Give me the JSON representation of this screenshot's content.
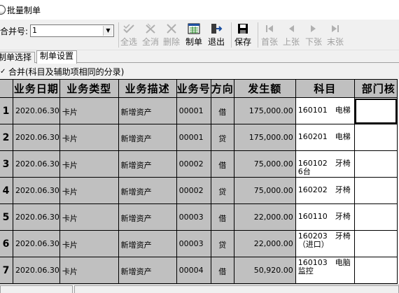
{
  "window": {
    "title": "批量制单"
  },
  "toolbar": {
    "voucher_label": "合并号:",
    "voucher_value": "1",
    "buttons": [
      {
        "label": "全选",
        "icon": "select-all-icon",
        "enabled": false
      },
      {
        "label": "全消",
        "icon": "deselect-all-icon",
        "enabled": false
      },
      {
        "label": "删除",
        "icon": "delete-icon",
        "enabled": false
      },
      {
        "label": "制单",
        "icon": "voucher-icon",
        "enabled": true
      },
      {
        "label": "退出",
        "icon": "exit-icon",
        "enabled": true
      },
      {
        "label": "保存",
        "icon": "save-icon",
        "enabled": true
      },
      {
        "label": "首张",
        "icon": "first-icon",
        "enabled": false
      },
      {
        "label": "上张",
        "icon": "prev-icon",
        "enabled": false
      },
      {
        "label": "下张",
        "icon": "next-icon",
        "enabled": false
      },
      {
        "label": "末张",
        "icon": "last-icon",
        "enabled": false
      }
    ]
  },
  "tabs": [
    {
      "label": "制单选择",
      "active": false
    },
    {
      "label": "制单设置",
      "active": true
    }
  ],
  "merge_option": {
    "checked": true,
    "label": "合并(科目及辅助项相同的分录)"
  },
  "table": {
    "columns": [
      "",
      "业务日期",
      "业务类型",
      "业务描述",
      "业务号",
      "方向",
      "发生额",
      "科目",
      "部门核"
    ],
    "rows": [
      {
        "no": "1",
        "date": "2020.06.30",
        "type": "卡片",
        "desc": "新增资产",
        "bizno": "00001",
        "dir": "借",
        "amount": "175,000.00",
        "subject": "160101　电梯"
      },
      {
        "no": "2",
        "date": "2020.06.30",
        "type": "卡片",
        "desc": "新增资产",
        "bizno": "00001",
        "dir": "贷",
        "amount": "175,000.00",
        "subject": "160201　电梯"
      },
      {
        "no": "3",
        "date": "2020.06.30",
        "type": "卡片",
        "desc": "新增资产",
        "bizno": "00002",
        "dir": "借",
        "amount": "75,000.00",
        "subject": "160102　牙椅6台"
      },
      {
        "no": "4",
        "date": "2020.06.30",
        "type": "卡片",
        "desc": "新增资产",
        "bizno": "00002",
        "dir": "贷",
        "amount": "75,000.00",
        "subject": "160202　牙椅"
      },
      {
        "no": "5",
        "date": "2020.06.30",
        "type": "卡片",
        "desc": "新增资产",
        "bizno": "00003",
        "dir": "借",
        "amount": "22,000.00",
        "subject": "160110　牙椅"
      },
      {
        "no": "6",
        "date": "2020.06.30",
        "type": "卡片",
        "desc": "新增资产",
        "bizno": "00003",
        "dir": "贷",
        "amount": "22,000.00",
        "subject": "160203　牙椅（进口）"
      },
      {
        "no": "7",
        "date": "2020.06.30",
        "type": "卡片",
        "desc": "新增资产",
        "bizno": "00004",
        "dir": "借",
        "amount": "50,920.00",
        "subject": "160103　电脑监控"
      }
    ]
  }
}
